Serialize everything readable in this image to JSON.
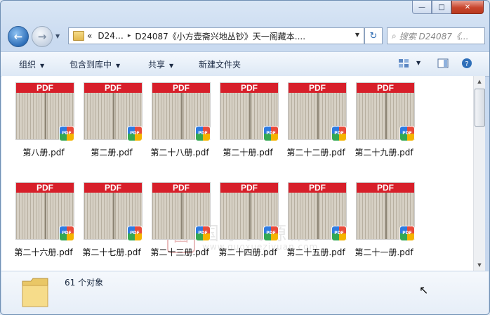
{
  "window": {
    "caption": {
      "minimize": "—",
      "maximize": "□",
      "close": "✕"
    }
  },
  "nav": {
    "back_icon": "←",
    "forward_icon": "→",
    "history_icon": "▼",
    "address": {
      "overflow": "«",
      "segment1": "D24…",
      "separator": "▸",
      "segment2": "D24087《小方壶斋兴地丛钞》天一阁藏本....",
      "dropdown": "▼"
    },
    "refresh_icon": "↻",
    "search": {
      "placeholder": "搜索 D24087《...",
      "icon": "⌕"
    }
  },
  "toolbar": {
    "organize": "组织",
    "include_in_library": "包含到库中",
    "share": "共享",
    "new_folder": "新建文件夹",
    "dropdown_arrow": "▼"
  },
  "files": [
    {
      "name": "第八册.pdf"
    },
    {
      "name": "第二册.pdf"
    },
    {
      "name": "第二十八册.pdf"
    },
    {
      "name": "第二十册.pdf"
    },
    {
      "name": "第二十二册.pdf"
    },
    {
      "name": "第二十九册.pdf"
    },
    {
      "name": "第二十六册.pdf"
    },
    {
      "name": "第二十七册.pdf"
    },
    {
      "name": "第二十三册.pdf"
    },
    {
      "name": "第二十四册.pdf"
    },
    {
      "name": "第二十五册.pdf"
    },
    {
      "name": "第二十一册.pdf"
    }
  ],
  "thumb_band_text": "PDF",
  "badge_text": "PDF",
  "watermark": {
    "title": "国學資源網",
    "url": "www.guoxueziyuan.com"
  },
  "status": {
    "count_text": "61 个对象"
  },
  "colors": {
    "pdf_red": "#d71f2a",
    "accent_blue": "#2f6fb9",
    "window_frame": "#c9daf0"
  }
}
